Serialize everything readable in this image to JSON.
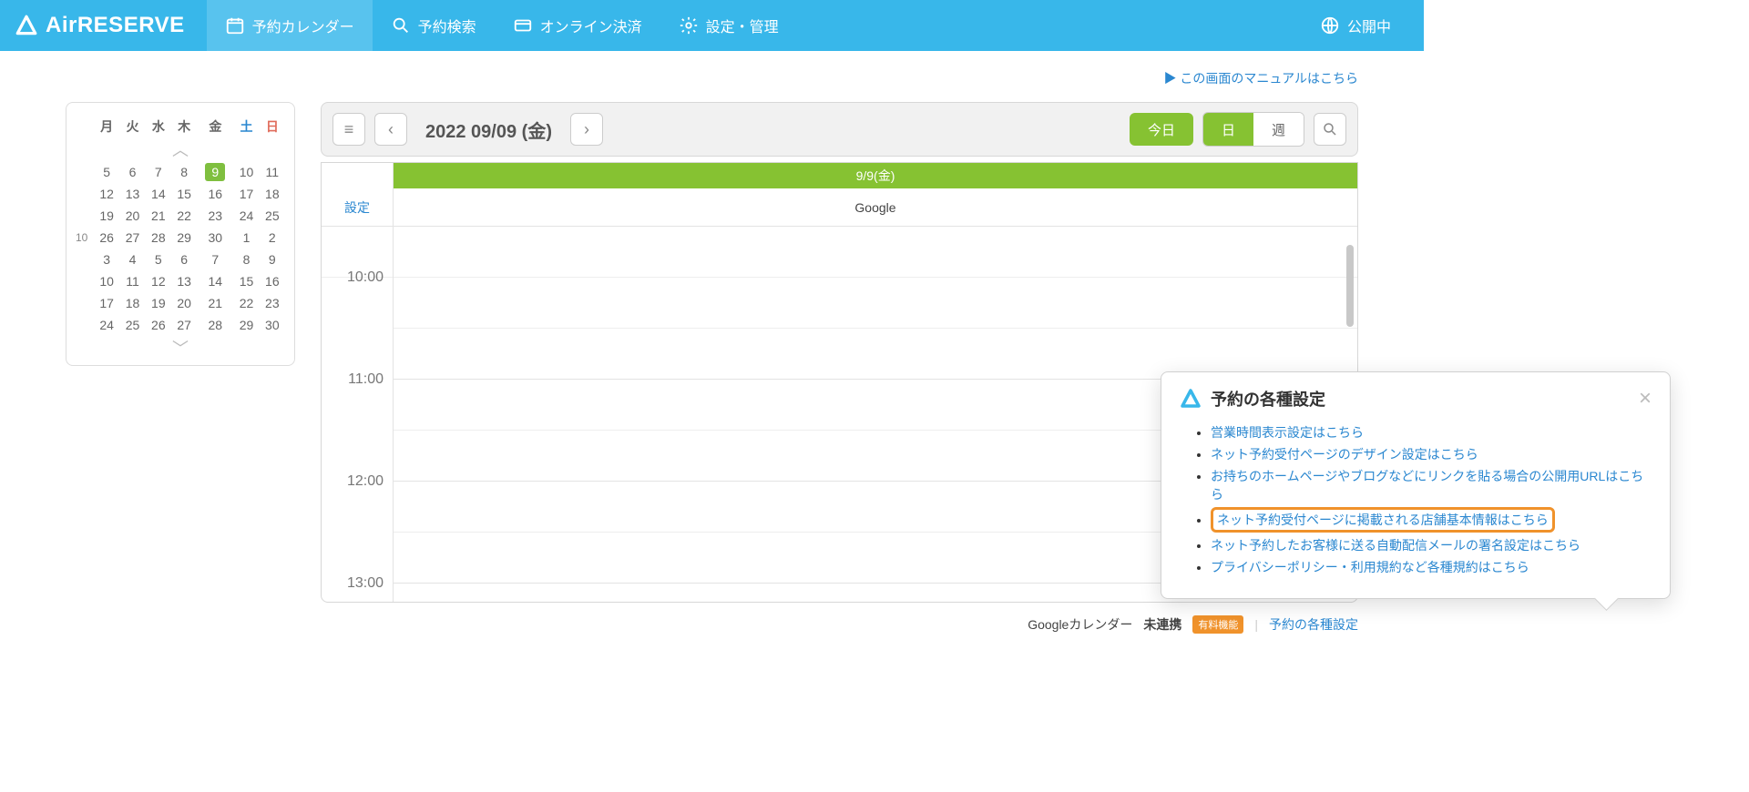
{
  "brand": "AirRESERVE",
  "nav": {
    "calendar": "予約カレンダー",
    "search": "予約検索",
    "payment": "オンライン決済",
    "settings": "設定・管理",
    "publish": "公開中"
  },
  "manual_link": "この画面のマニュアルはこちら",
  "mini_calendar": {
    "dow": [
      "月",
      "火",
      "水",
      "木",
      "金",
      "土",
      "日"
    ],
    "month_label": "10",
    "today": 9,
    "rows": [
      [
        5,
        6,
        7,
        8,
        9,
        10,
        11
      ],
      [
        12,
        13,
        14,
        15,
        16,
        17,
        18
      ],
      [
        19,
        20,
        21,
        22,
        23,
        24,
        25
      ],
      [
        26,
        27,
        28,
        29,
        30,
        1,
        2
      ],
      [
        3,
        4,
        5,
        6,
        7,
        8,
        9
      ],
      [
        10,
        11,
        12,
        13,
        14,
        15,
        16
      ],
      [
        17,
        18,
        19,
        20,
        21,
        22,
        23
      ],
      [
        24,
        25,
        26,
        27,
        28,
        29,
        30
      ]
    ]
  },
  "toolbar": {
    "date_label": "2022 09/09 (金)",
    "today": "今日",
    "day": "日",
    "week": "週"
  },
  "calendar": {
    "date_strip": "9/9(金)",
    "settings": "設定",
    "google": "Google",
    "times": [
      "10:00",
      "11:00",
      "12:00",
      "13:00"
    ]
  },
  "bottom": {
    "gcal_label": "Googleカレンダー",
    "gcal_status": "未連携",
    "paid_badge": "有料機能",
    "settings_link": "予約の各種設定"
  },
  "popup": {
    "title": "予約の各種設定",
    "links": [
      "営業時間表示設定はこちら",
      "ネット予約受付ページのデザイン設定はこちら",
      "お持ちのホームページやブログなどにリンクを貼る場合の公開用URLはこちら",
      "ネット予約受付ページに掲載される店舗基本情報はこちら",
      "ネット予約したお客様に送る自動配信メールの署名設定はこちら",
      "プライバシーポリシー・利用規約など各種規約はこちら"
    ],
    "highlight_index": 3
  }
}
